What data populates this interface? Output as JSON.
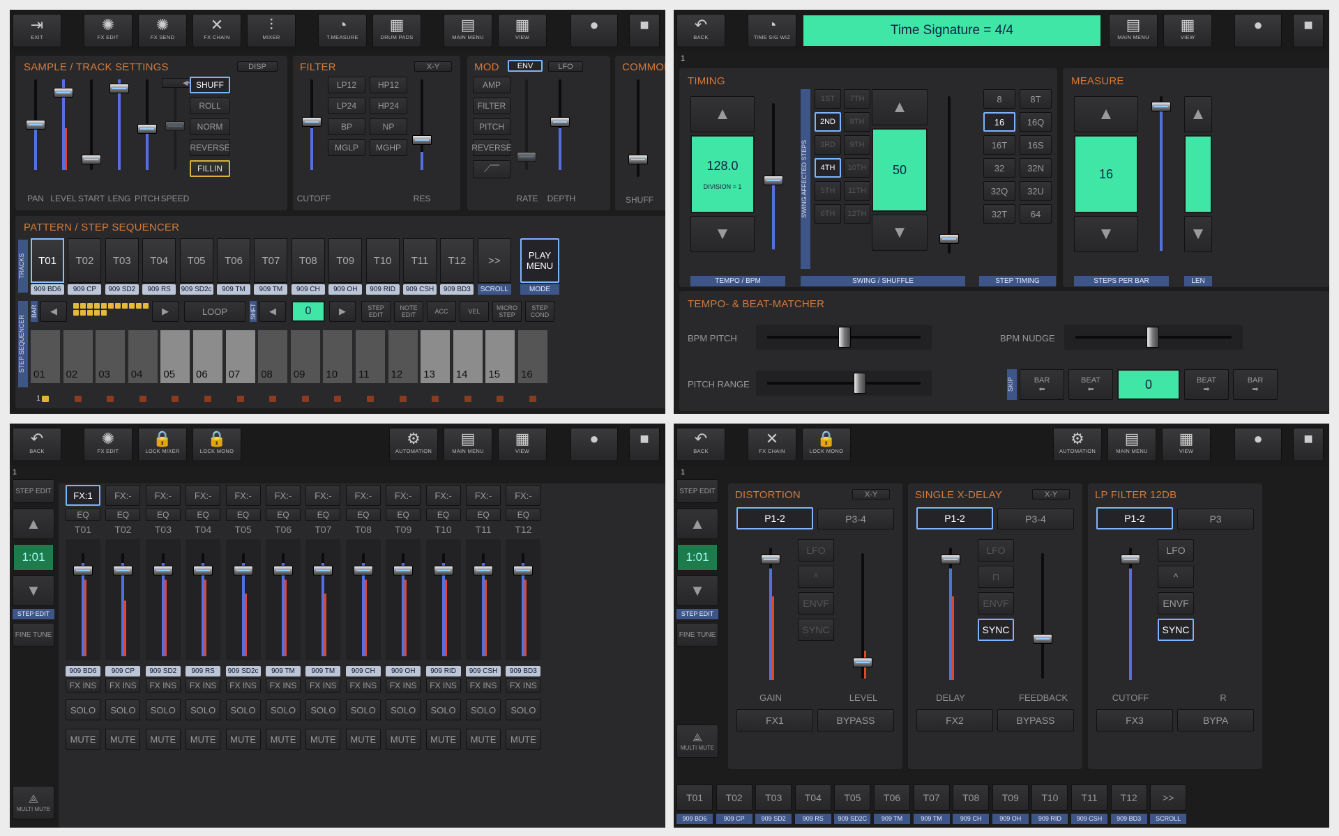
{
  "q1": {
    "toolbar": [
      {
        "icon": "⇥",
        "label": "EXIT"
      },
      {
        "icon": "✺",
        "label": "FX EDIT"
      },
      {
        "icon": "✺",
        "label": "FX SEND"
      },
      {
        "icon": "✕",
        "label": "FX CHAIN"
      },
      {
        "icon": "⫶",
        "label": "MIXER"
      },
      {
        "icon": "◔",
        "label": "T.MEASURE"
      },
      {
        "icon": "▦",
        "label": "DRUM PADS"
      },
      {
        "icon": "▤",
        "label": "MAIN MENU"
      },
      {
        "icon": "▦",
        "label": "VIEW"
      },
      {
        "icon": "●",
        "label": ""
      },
      {
        "icon": "■",
        "label": ""
      }
    ],
    "sample_title": "SAMPLE / TRACK SETTINGS",
    "disp": "DISP",
    "sample_faders": [
      "PAN",
      "LEVEL",
      "START",
      "LENG",
      "PITCH",
      "SPEED"
    ],
    "sample_btns": [
      "SHUFF",
      "ROLL",
      "NORM",
      "REVERSE",
      "FILLIN"
    ],
    "filter_title": "FILTER",
    "xy": "X-Y",
    "filter_btns": [
      "LP12",
      "HP12",
      "LP24",
      "HP24",
      "BP",
      "NP",
      "MGLP",
      "MGHP"
    ],
    "filter_labels": [
      "CUTOFF",
      "RES"
    ],
    "mod_title": "MOD",
    "env": "ENV",
    "lfo": "LFO",
    "mod_btns": [
      "AMP",
      "FILTER",
      "PITCH",
      "REVERSE"
    ],
    "mod_labels": [
      "RATE",
      "DEPTH"
    ],
    "common_title": "COMMON",
    "common_label": "SHUFF",
    "pattern_title": "PATTERN / STEP SEQUENCER",
    "tracks_label": "TRACKS",
    "tracks": [
      "T01",
      "T02",
      "T03",
      "T04",
      "T05",
      "T06",
      "T07",
      "T08",
      "T09",
      "T10",
      "T11",
      "T12",
      ">>"
    ],
    "track_tags": [
      "909 BD6",
      "909 CP",
      "909 SD2",
      "909 RS",
      "909 SD2c",
      "909 TM",
      "909 TM",
      "909 CH",
      "909 OH",
      "909 RID",
      "909 CSH",
      "909 BD3",
      "SCROLL"
    ],
    "play_menu": "PLAY MENU",
    "mode": "MODE",
    "seq_label": "STEP SEQUENCER",
    "bar": "BAR",
    "loop": "LOOP",
    "shift": "SHFT",
    "shift_value": "0",
    "seq_btns": [
      "STEP EDIT",
      "NOTE EDIT",
      "ACC",
      "VEL",
      "MICRO STEP",
      "STEP COND"
    ],
    "steps": [
      "01",
      "02",
      "03",
      "04",
      "05",
      "06",
      "07",
      "08",
      "09",
      "10",
      "11",
      "12",
      "13",
      "14",
      "15",
      "16"
    ],
    "bar_num": "1"
  },
  "q2": {
    "toolbar": [
      {
        "icon": "↶",
        "label": "BACK"
      },
      {
        "icon": "◔",
        "label": "TIME SIG WIZ"
      },
      {
        "icon": "▤",
        "label": "MAIN MENU"
      },
      {
        "icon": "▦",
        "label": "VIEW"
      },
      {
        "icon": "●",
        "label": ""
      },
      {
        "icon": "■",
        "label": ""
      }
    ],
    "banner": "Time Signature = 4/4",
    "timing_title": "TIMING",
    "tempo": "128.0",
    "division": "DIVISION = 1",
    "tempo_label": "TEMPO / BPM",
    "swing_vlabel": "SWING AFFECTED STEPS",
    "swing_steps": [
      [
        "1ST",
        "7TH"
      ],
      [
        "2ND",
        "8TH"
      ],
      [
        "3RD",
        "9TH"
      ],
      [
        "4TH",
        "10TH"
      ],
      [
        "5TH",
        "11TH"
      ],
      [
        "6TH",
        "12TH"
      ]
    ],
    "swing_value": "50",
    "swing_label": "SWING / SHUFFLE",
    "step_timing": [
      [
        "8",
        "8T"
      ],
      [
        "16",
        "16Q"
      ],
      [
        "16T",
        "16S"
      ],
      [
        "32",
        "32N"
      ],
      [
        "32Q",
        "32U"
      ],
      [
        "32T",
        "64"
      ]
    ],
    "step_timing_label": "STEP TIMING",
    "measure_title": "MEASURE",
    "measure_value": "16",
    "measure_label": "STEPS PER BAR",
    "len_label": "LEN",
    "beat_title": "TEMPO- & BEAT-MATCHER",
    "bpm_pitch": "BPM PITCH",
    "bpm_nudge": "BPM NUDGE",
    "pitch_range": "PITCH RANGE",
    "skip": "SKIP",
    "skip_btns": [
      "BAR",
      "BEAT",
      "BEAT",
      "BAR"
    ],
    "skip_value": "0",
    "bar_num": "1"
  },
  "q3": {
    "toolbar": [
      {
        "icon": "↶",
        "label": "BACK"
      },
      {
        "icon": "✺",
        "label": "FX EDIT"
      },
      {
        "icon": "🔒",
        "label": "LOCK MIXER"
      },
      {
        "icon": "🔒",
        "label": "LOCK MONO"
      },
      {
        "icon": "⚙",
        "label": "AUTOMATION"
      },
      {
        "icon": "▤",
        "label": "MAIN MENU"
      },
      {
        "icon": "▦",
        "label": "VIEW"
      },
      {
        "icon": "●",
        "label": ""
      },
      {
        "icon": "■",
        "label": ""
      }
    ],
    "side": {
      "step_edit": "STEP EDIT",
      "pos": "1:01",
      "step_edit_tag": "STEP EDIT",
      "fine_tune": "FINE TUNE",
      "multi_mute": "MULTI MUTE"
    },
    "fx": [
      "FX:1",
      "FX:-",
      "FX:-",
      "FX:-",
      "FX:-",
      "FX:-",
      "FX:-",
      "FX:-",
      "FX:-",
      "FX:-",
      "FX:-",
      "FX:-"
    ],
    "eq": "EQ",
    "tracks": [
      "T01",
      "T02",
      "T03",
      "T04",
      "T05",
      "T06",
      "T07",
      "T08",
      "T09",
      "T10",
      "T11",
      "T12"
    ],
    "tags": [
      "909 BD6",
      "909 CP",
      "909 SD2",
      "909 RS",
      "909 SD2c",
      "909 TM",
      "909 TM",
      "909 CH",
      "909 OH",
      "909 RID",
      "909 CSH",
      "909 BD3"
    ],
    "fx_ins": "FX INS",
    "solo": "SOLO",
    "mute": "MUTE",
    "bar_num": "1"
  },
  "q4": {
    "toolbar": [
      {
        "icon": "↶",
        "label": "BACK"
      },
      {
        "icon": "✕",
        "label": "FX CHAIN"
      },
      {
        "icon": "🔒",
        "label": "LOCK MONO"
      },
      {
        "icon": "⚙",
        "label": "AUTOMATION"
      },
      {
        "icon": "▤",
        "label": "MAIN MENU"
      },
      {
        "icon": "▦",
        "label": "VIEW"
      },
      {
        "icon": "●",
        "label": ""
      },
      {
        "icon": "■",
        "label": ""
      }
    ],
    "side": {
      "step_edit": "STEP EDIT",
      "pos": "1:01",
      "step_edit_tag": "STEP EDIT",
      "fine_tune": "FINE TUNE",
      "multi_mute": "MULTI MUTE"
    },
    "fx_panels": [
      {
        "title": "DISTORTION",
        "xy": "X-Y",
        "p1": "P1-2",
        "p2": "P3-4",
        "mods": [
          "LFO",
          "^",
          "ENVF",
          "SYNC"
        ],
        "labels": [
          "GAIN",
          "LEVEL"
        ],
        "fx": "FX1",
        "bypass": "BYPASS"
      },
      {
        "title": "SINGLE X-DELAY",
        "xy": "X-Y",
        "p1": "P1-2",
        "p2": "P3-4",
        "mods": [
          "LFO",
          "⊓",
          "ENVF",
          "SYNC"
        ],
        "labels": [
          "DELAY",
          "FEEDBACK"
        ],
        "fx": "FX2",
        "bypass": "BYPASS"
      },
      {
        "title": "LP FILTER 12DB",
        "xy": "",
        "p1": "P1-2",
        "p2": "P3",
        "mods": [
          "LFO",
          "^",
          "ENVF",
          "SYNC"
        ],
        "labels": [
          "CUTOFF",
          "R"
        ],
        "fx": "FX3",
        "bypass": "BYPA"
      }
    ],
    "tracks": [
      "T01",
      "T02",
      "T03",
      "T04",
      "T05",
      "T06",
      "T07",
      "T08",
      "T09",
      "T10",
      "T11",
      "T12",
      ">>"
    ],
    "tags": [
      "909 BD6",
      "909 CP",
      "909 SD2",
      "909 RS",
      "909 SD2c",
      "909 TM",
      "909 TM",
      "909 CH",
      "909 OH",
      "909 RID",
      "909 CSH",
      "909 BD3",
      "SCROLL"
    ],
    "bar_num": "1"
  }
}
